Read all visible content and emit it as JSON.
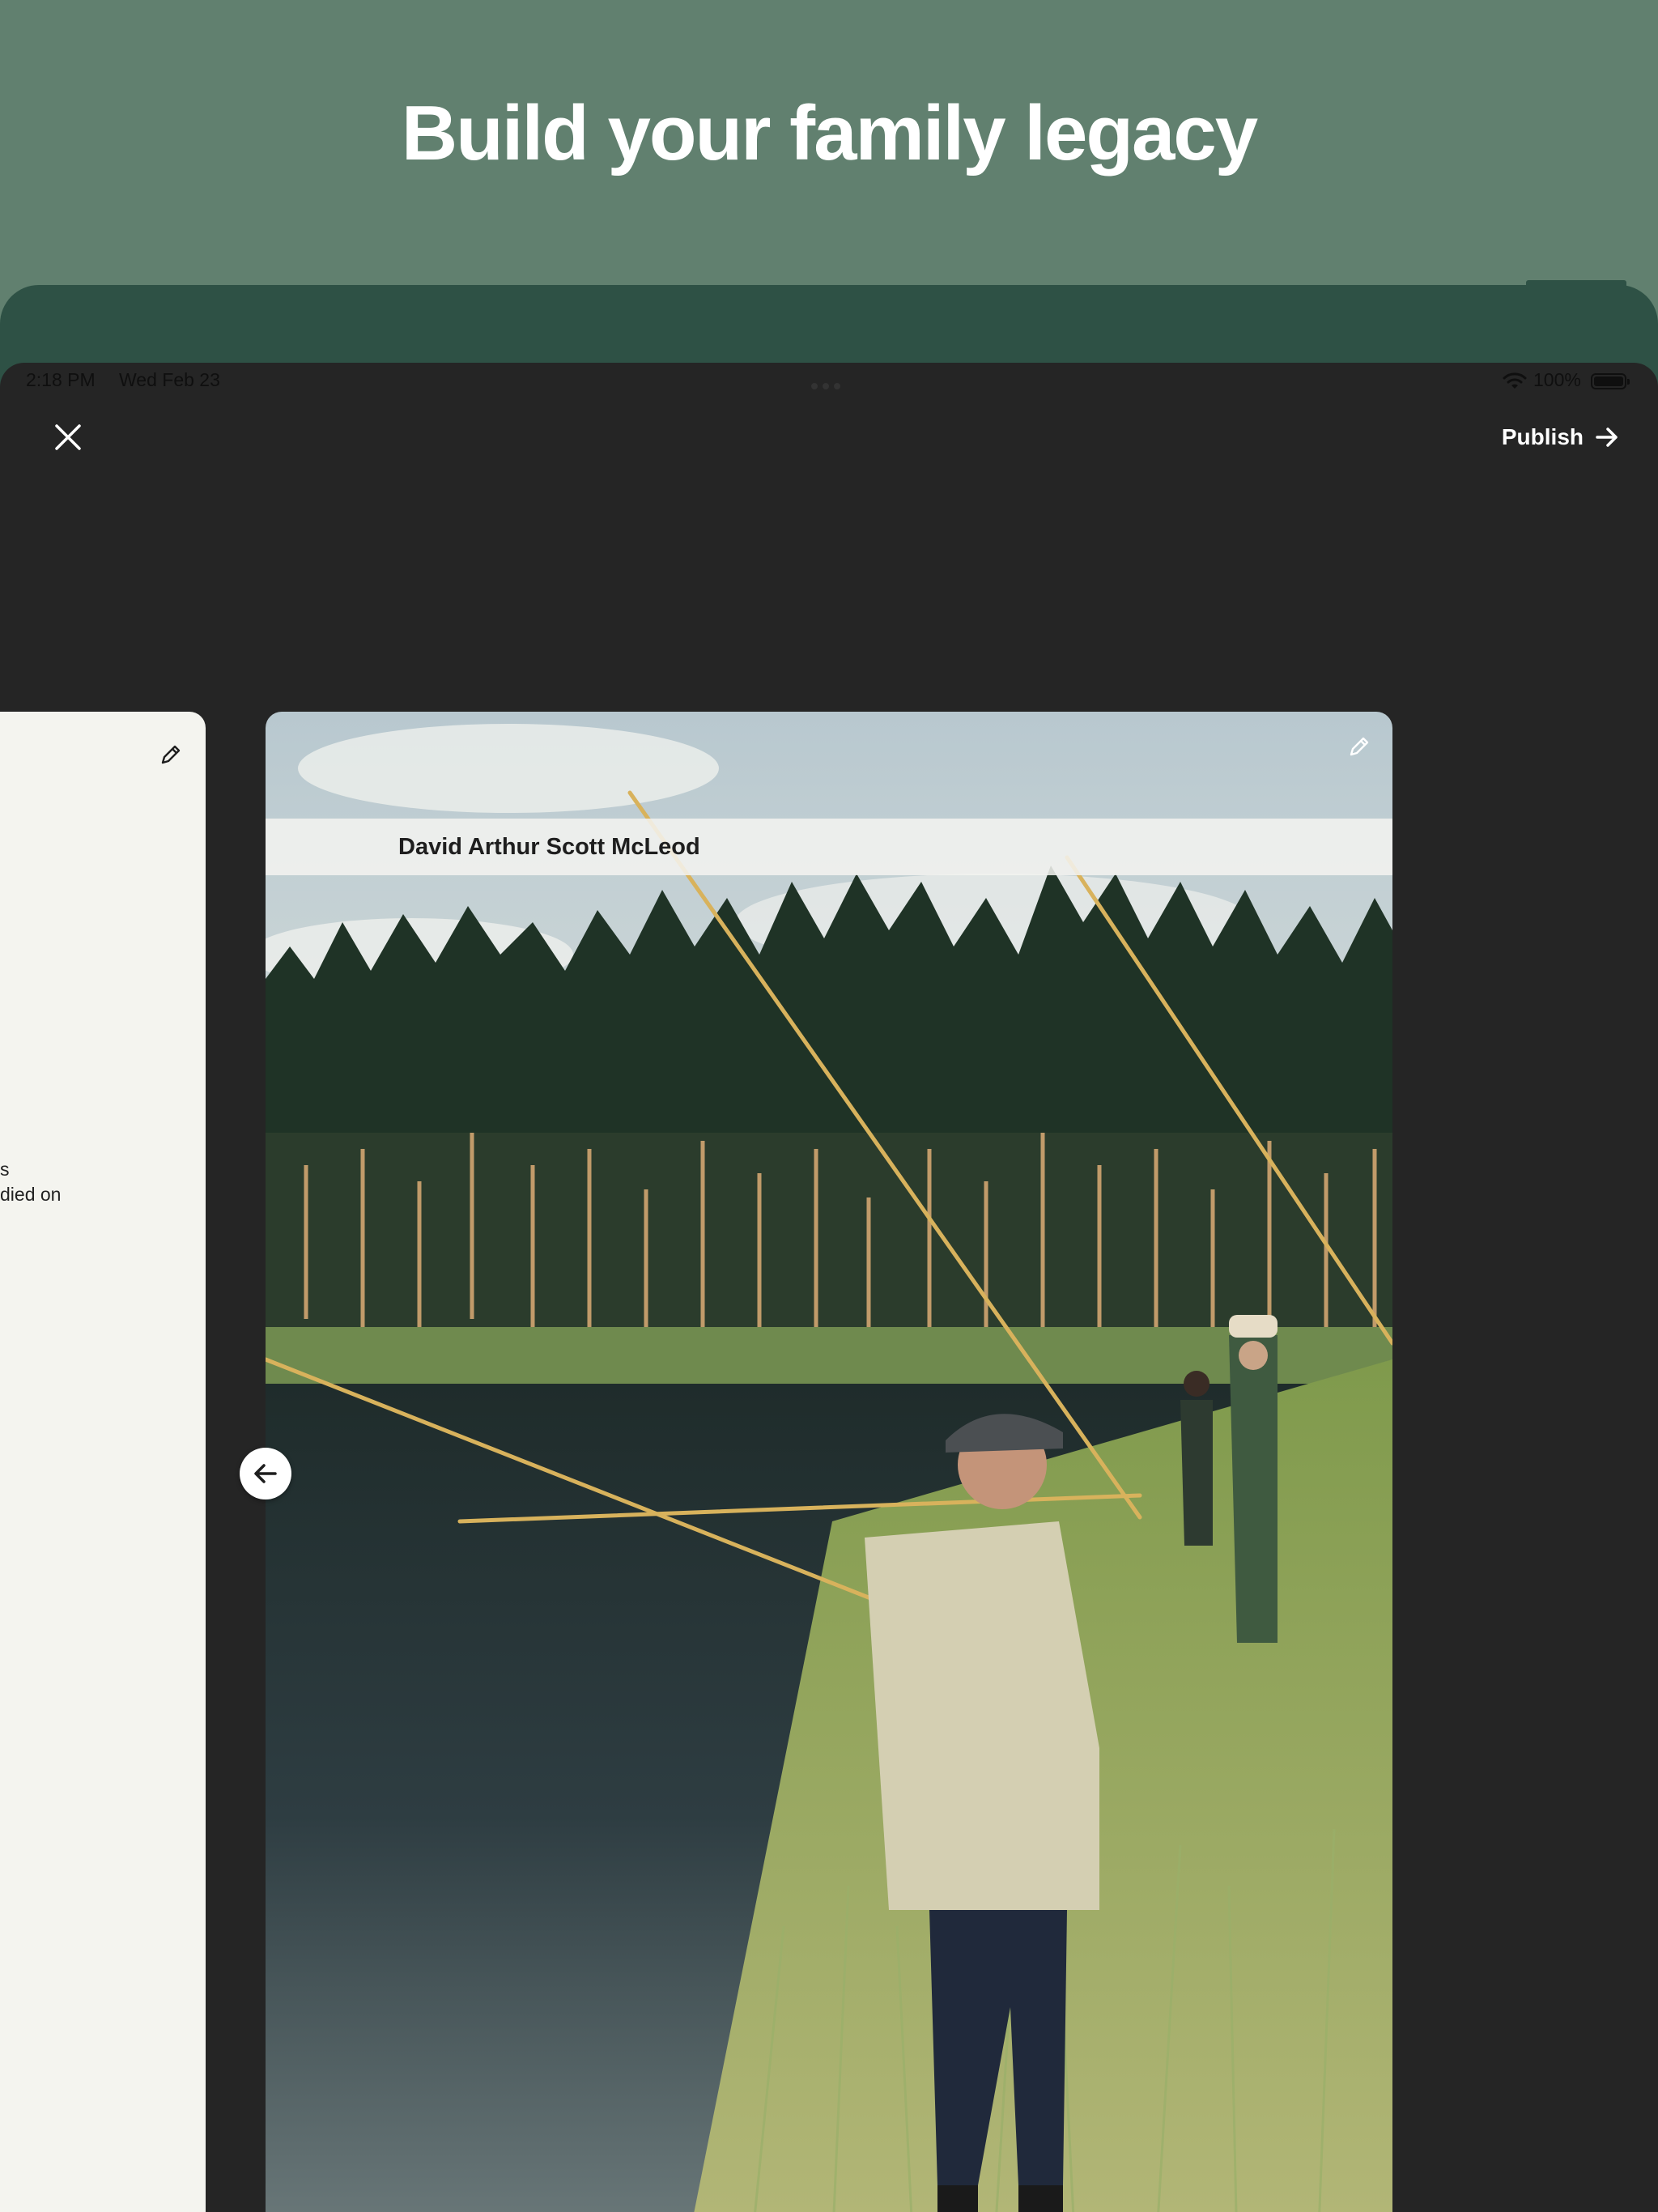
{
  "marketing": {
    "headline": "Build your family legacy"
  },
  "status_bar": {
    "time": "2:18 PM",
    "date": "Wed Feb 23",
    "battery": "100%"
  },
  "toolbar": {
    "publish_label": "Publish"
  },
  "previous_card": {
    "text_lines": [
      "s",
      "died on"
    ]
  },
  "photo_card": {
    "name": "David Arthur Scott McLeod"
  },
  "colors": {
    "marketing_background": "#61806f",
    "device_frame": "#2e5145",
    "screen_background": "#252525",
    "card_background": "#f4f4ef",
    "text_light": "#ffffff"
  },
  "icons": [
    "close-icon",
    "arrow-right-icon",
    "pencil-icon",
    "arrow-left-icon",
    "wifi-icon",
    "battery-icon"
  ]
}
